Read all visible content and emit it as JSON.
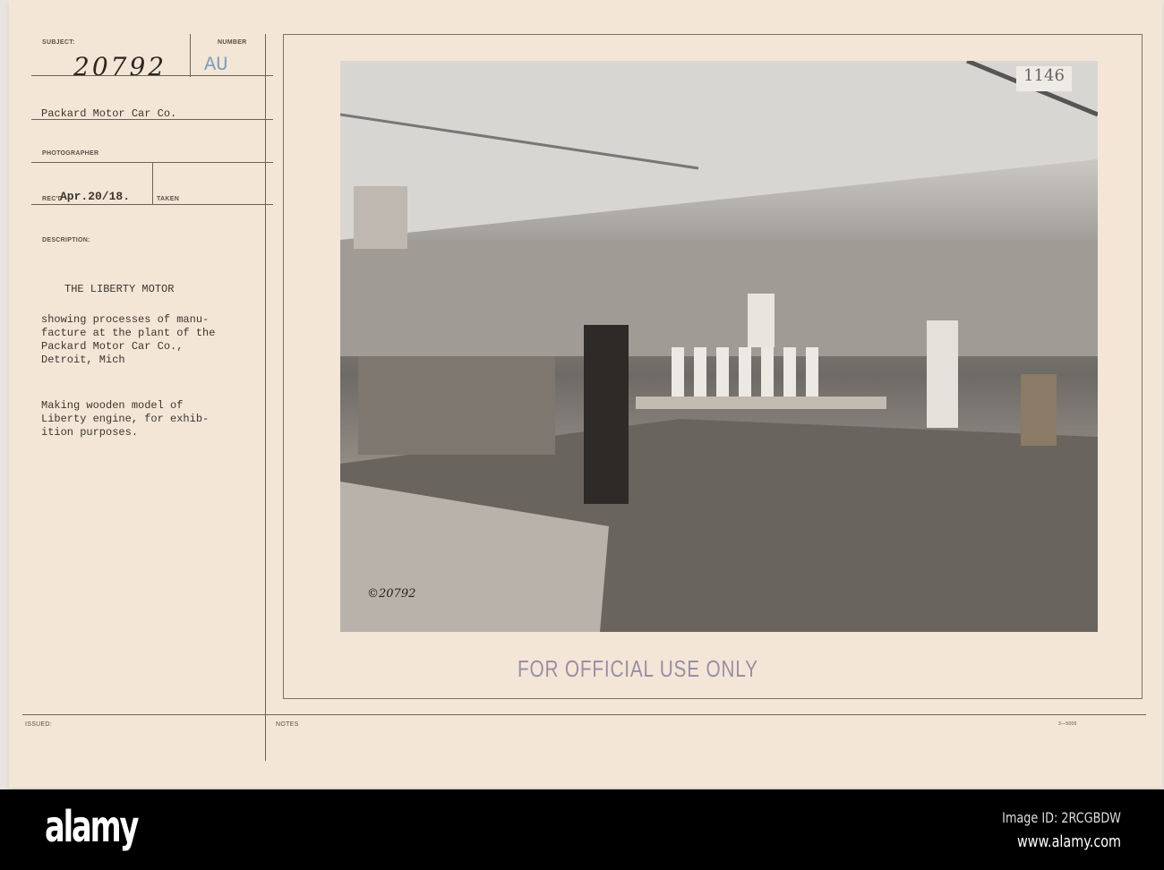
{
  "card": {
    "subject_label": "SUBJECT:",
    "number_label": "NUMBER",
    "subject_number": "20792",
    "number_code": "AU",
    "company": "Packard Motor Car Co.",
    "photographer_label": "PHOTOGRAPHER",
    "recd_label": "REC'D",
    "recd_date": "Apr.20/18.",
    "taken_label": "TAKEN",
    "description_label": "DESCRIPTION:",
    "title": "THE LIBERTY MOTOR",
    "description_lines": [
      "showing processes of manu-",
      "facture at the plant of the",
      "Packard Motor Car Co.,",
      "Detroit, Mich"
    ],
    "caption_lines": [
      "Making wooden model of",
      "Liberty engine, for exhib-",
      "ition purposes."
    ],
    "issued_label": "ISSUED:",
    "notes_label": "NOTES",
    "form_number": "3—5005",
    "stamp": "FOR OFFICIAL USE ONLY"
  },
  "photo": {
    "corner_mark": "1146",
    "plate_number": "©20792"
  },
  "footer": {
    "logo": "alamy",
    "image_id": "Image ID: 2RCGBDW",
    "url": "www.alamy.com"
  }
}
